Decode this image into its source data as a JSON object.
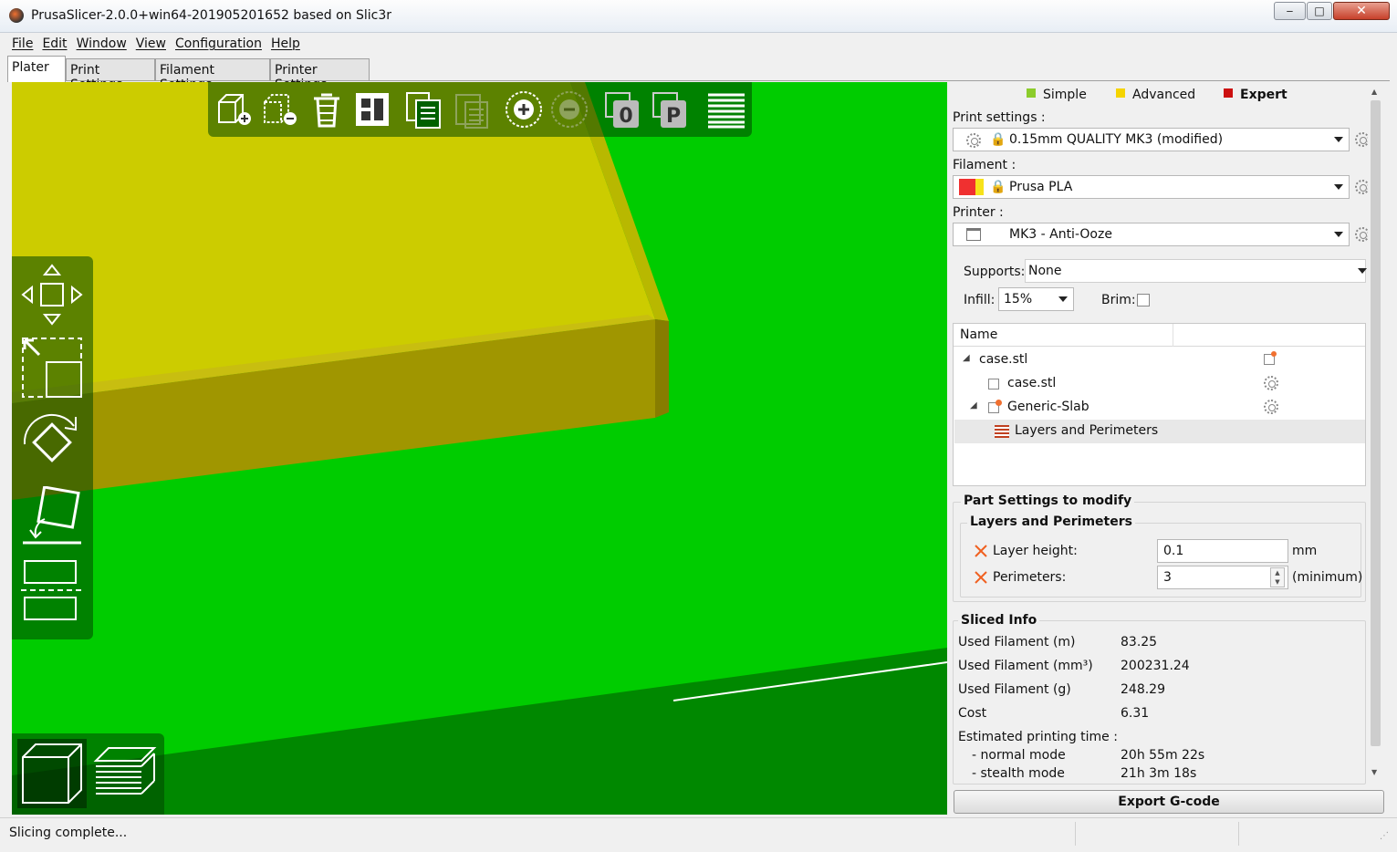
{
  "window": {
    "title": "PrusaSlicer-2.0.0+win64-201905201652 based on Slic3r",
    "minimize": "‒",
    "maximize": "□",
    "close": "✕"
  },
  "menu": [
    "File",
    "Edit",
    "Window",
    "View",
    "Configuration",
    "Help"
  ],
  "tabs": [
    "Plater",
    "Print Settings",
    "Filament Settings",
    "Printer Settings"
  ],
  "toolbar_icons": [
    "add-icon",
    "delete-icon",
    "delete-all-icon",
    "arrange-icon",
    "copy-icon",
    "paste-icon",
    "instance-add-icon",
    "instance-remove-icon",
    "split-objects-icon",
    "split-parts-icon",
    "layer-editing-icon"
  ],
  "gizmo_icons": [
    "move-icon",
    "scale-icon",
    "rotate-icon",
    "place-on-face-icon",
    "cut-icon"
  ],
  "view_icons": [
    "3d-view-icon",
    "preview-icon"
  ],
  "colors": {
    "bed": "#00cc00",
    "object": "#cccc00",
    "simple": "#8ccc2c",
    "advanced": "#f5d400",
    "expert": "#cc1010",
    "filament_red": "#f03030",
    "filament_yellow": "#f7e21a"
  },
  "modes": {
    "simple": "Simple",
    "advanced": "Advanced",
    "expert": "Expert"
  },
  "print_settings": {
    "label": "Print settings :",
    "value": "0.15mm QUALITY MK3 (modified)"
  },
  "filament": {
    "label": "Filament :",
    "value": "Prusa PLA"
  },
  "printer": {
    "label": "Printer :",
    "value": "MK3 - Anti-Ooze"
  },
  "supports": {
    "label": "Supports:",
    "value": "None"
  },
  "infill": {
    "label": "Infill:",
    "value": "15%"
  },
  "brim": {
    "label": "Brim:",
    "checked": false
  },
  "object_list": {
    "header": "Name",
    "rows": [
      {
        "label": "case.stl",
        "level": 0
      },
      {
        "label": "case.stl",
        "level": 1
      },
      {
        "label": "Generic-Slab",
        "level": 1
      },
      {
        "label": "Layers and Perimeters",
        "level": 2
      }
    ]
  },
  "part_settings": {
    "title": "Part Settings to modify",
    "subtitle": "Layers and Perimeters",
    "layer_height": {
      "label": "Layer height:",
      "value": "0.1",
      "unit": "mm"
    },
    "perimeters": {
      "label": "Perimeters:",
      "value": "3",
      "unit": "(minimum)"
    }
  },
  "sliced_info": {
    "title": "Sliced Info",
    "rows": [
      {
        "label": "Used Filament (m)",
        "value": "83.25"
      },
      {
        "label": "Used Filament (mm³)",
        "value": "200231.24"
      },
      {
        "label": "Used Filament (g)",
        "value": "248.29"
      },
      {
        "label": "Cost",
        "value": "6.31"
      }
    ],
    "time_label": "Estimated printing time :",
    "normal_label": "- normal mode",
    "normal_value": "20h 55m 22s",
    "stealth_label": "- stealth mode",
    "stealth_value": "21h 3m 18s"
  },
  "export_button": "Export G-code",
  "status": "Slicing complete..."
}
